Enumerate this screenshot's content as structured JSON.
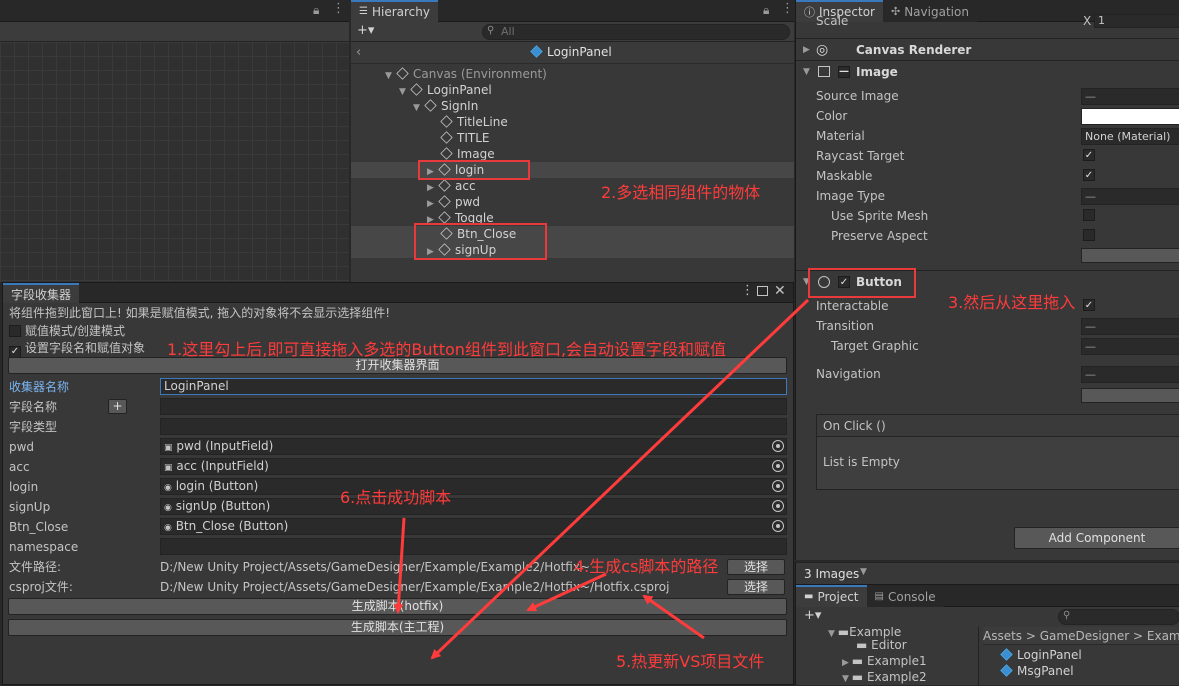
{
  "hierarchy": {
    "tab_label": "Hierarchy",
    "add_label": "+▾",
    "search_placeholder": "All",
    "breadcrumb": "LoginPanel",
    "items": [
      {
        "label": "Canvas (Environment)"
      },
      {
        "label": "LoginPanel"
      },
      {
        "label": "SignIn"
      },
      {
        "label": "TitleLine"
      },
      {
        "label": "TITLE"
      },
      {
        "label": "Image"
      },
      {
        "label": "login"
      },
      {
        "label": "acc"
      },
      {
        "label": "pwd"
      },
      {
        "label": "Toggle"
      },
      {
        "label": "Btn_Close"
      },
      {
        "label": "signUp"
      }
    ]
  },
  "inspector": {
    "tabs": [
      {
        "label": "Inspector"
      },
      {
        "label": "Navigation"
      }
    ],
    "scale_label": "Scale",
    "scale_x": "X",
    "scale_x_value": "1",
    "canvas_renderer": "Canvas Renderer",
    "image_component": "Image",
    "image_props": {
      "source_image": "Source Image",
      "source_image_value": "—",
      "color": "Color",
      "material": "Material",
      "material_value": "None (Material)",
      "raycast_target": "Raycast Target",
      "maskable": "Maskable",
      "image_type": "Image Type",
      "image_type_value": "—",
      "use_sprite_mesh": "Use Sprite Mesh",
      "preserve_aspect": "Preserve Aspect"
    },
    "button_component": "Button",
    "button_props": {
      "interactable": "Interactable",
      "transition": "Transition",
      "transition_value": "—",
      "target_graphic": "Target Graphic",
      "target_graphic_value": "—",
      "navigation": "Navigation",
      "navigation_value": "—"
    },
    "on_click": "On Click ()",
    "list_empty": "List is Empty",
    "add_component": "Add Component",
    "images_count": "3 Images"
  },
  "project": {
    "tabs": [
      {
        "label": "Project"
      },
      {
        "label": "Console"
      }
    ],
    "add_label": "+▾",
    "tree": [
      {
        "label": "Example"
      },
      {
        "label": "Editor"
      },
      {
        "label": "Example1"
      },
      {
        "label": "Example2"
      }
    ],
    "breadcrumb": "Assets > GameDesigner > Examp",
    "assets": [
      {
        "label": "LoginPanel"
      },
      {
        "label": "MsgPanel"
      }
    ]
  },
  "collector": {
    "title": "字段收集器",
    "hint": "将组件拖到此窗口上! 如果是赋值模式, 拖入的对象将不会显示选择组件!",
    "assign_mode": "赋值模式/创建模式",
    "set_field_name": "设置字段名和赋值对象",
    "open_button": "打开收集器界面",
    "collector_name_label": "收集器名称",
    "collector_name_value": "LoginPanel",
    "field_name_label": "字段名称",
    "add_field": "+",
    "field_type_label": "字段类型",
    "fields": [
      {
        "name": "pwd",
        "value": "pwd (InputField)",
        "icon": "inputfield-icon"
      },
      {
        "name": "acc",
        "value": "acc (InputField)",
        "icon": "inputfield-icon"
      },
      {
        "name": "login",
        "value": "login (Button)",
        "icon": "button-icon"
      },
      {
        "name": "signUp",
        "value": "signUp (Button)",
        "icon": "button-icon"
      },
      {
        "name": "Btn_Close",
        "value": "Btn_Close (Button)",
        "icon": "button-icon"
      }
    ],
    "namespace_label": "namespace",
    "file_path_label": "文件路径:",
    "file_path_value": "D:/New Unity Project/Assets/GameDesigner/Example/Example2/Hotfix~",
    "csproj_label": "csproj文件:",
    "csproj_value": "D:/New Unity Project/Assets/GameDesigner/Example/Example2/Hotfix~/Hotfix.csproj",
    "select_label": "选择",
    "gen_hotfix": "生成脚本(hotfix)",
    "gen_main": "生成脚本(主工程)"
  },
  "annotations": {
    "step1": "1.这里勾上后,即可直接拖入多选的Button组件到此窗口,会自动设置字段和赋值",
    "step2": "2.多选相同组件的物体",
    "step3": "3.然后从这里拖入",
    "step4": "4.生成cs脚本的路径",
    "step5": "5.热更新VS项目文件",
    "step6": "6.点击成功脚本",
    "color": "#ff3b3b"
  }
}
